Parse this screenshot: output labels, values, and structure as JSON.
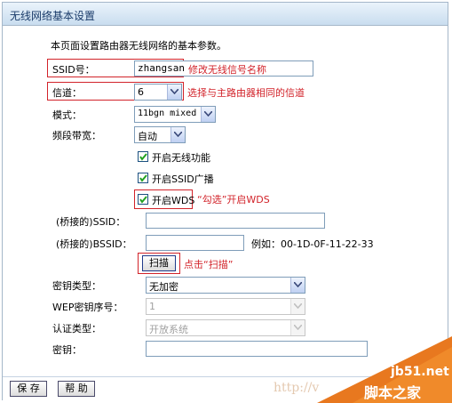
{
  "title": "无线网络基本设置",
  "description": "本页面设置路由器无线网络的基本参数。",
  "ssid": {
    "label": "SSID号：",
    "value": "zhangsan",
    "note": "修改无线信号名称"
  },
  "channel": {
    "label": "信道：",
    "value": "6",
    "note": "选择与主路由器相同的信道"
  },
  "mode": {
    "label": "模式：",
    "value": "11bgn mixed"
  },
  "bandwidth": {
    "label": "频段带宽：",
    "value": "自动"
  },
  "checkboxes": [
    {
      "label": "开启无线功能",
      "checked": true
    },
    {
      "label": "开启SSID广播",
      "checked": true
    },
    {
      "label": "开启WDS",
      "checked": true,
      "note": "“勾选”开启WDS"
    }
  ],
  "bridge_ssid": {
    "label": "(桥接的)SSID：",
    "value": ""
  },
  "bridge_bssid": {
    "label": "(桥接的)BSSID：",
    "value": "",
    "example": "例如：00-1D-0F-11-22-33"
  },
  "scan": {
    "label": "扫描",
    "note": "点击“扫描”"
  },
  "key_type": {
    "label": "密钥类型：",
    "value": "无加密"
  },
  "wep_index": {
    "label": "WEP密钥序号：",
    "value": "1"
  },
  "auth_type": {
    "label": "认证类型：",
    "value": "开放系统"
  },
  "key": {
    "label": "密钥：",
    "value": ""
  },
  "buttons": {
    "save": "保 存",
    "help": "帮 助"
  },
  "watermark": {
    "url": "http://v",
    "site": "jb51.net",
    "name": "脚本之家"
  },
  "colors": {
    "accent_red": "#d2232a",
    "border_blue": "#7f9db9",
    "title_text": "#1a3b6a"
  }
}
